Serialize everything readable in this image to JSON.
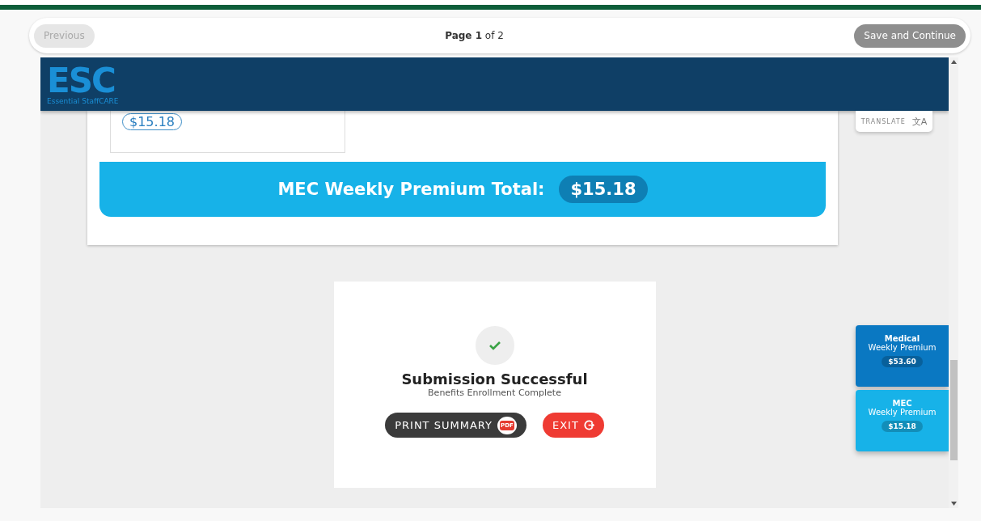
{
  "nav": {
    "previous": {
      "label": "Previous",
      "disabled": true
    },
    "page": "**Page 1** of 2",
    "next": {
      "label": "Save and Continue",
      "disabled": false
    }
  },
  "header": {
    "logo": "ESC",
    "tagline": "Essential StaffCARE"
  },
  "translate": {
    "label": "TRANSLATE",
    "icon": "文A"
  },
  "plan_card": {
    "amount": "$15.18"
  },
  "total_bar": {
    "label": "MEC Weekly Premium Total:",
    "amount": "$15.18"
  },
  "success": {
    "title": "Submission Successful",
    "subtitle": "Benefits Enrollment Complete",
    "buttons": [
      {
        "kind": "print",
        "label": "PRINT SUMMARY",
        "icon": "PDF"
      },
      {
        "kind": "exit",
        "label": "EXIT"
      }
    ]
  },
  "premiums": [
    {
      "name": "Medical",
      "label": "Weekly Premium",
      "amount": "$53.60",
      "color": "#0a78c2"
    },
    {
      "name": "MEC",
      "label": "Weekly Premium",
      "amount": "$15.18",
      "color": "#17b2e8"
    }
  ]
}
